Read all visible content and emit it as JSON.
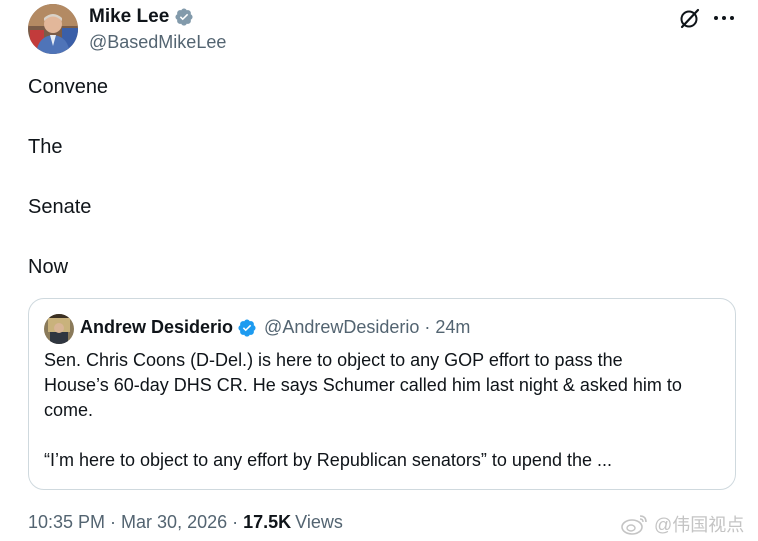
{
  "author": {
    "name": "Mike Lee",
    "handle": "@BasedMikeLee"
  },
  "tweet_lines": [
    "Convene",
    "The",
    "Senate",
    "Now"
  ],
  "quote": {
    "name": "Andrew Desiderio",
    "handle": "@AndrewDesiderio",
    "dot": "·",
    "time": "24m",
    "text_lines": [
      "Sen. Chris Coons (D-Del.) is here to object to any GOP effort to pass the",
      "House’s 60-day DHS CR. He says Schumer called him last night & asked him to",
      "come.",
      "“I’m here to object to any effort by Republican senators” to upend the ..."
    ]
  },
  "meta": {
    "time": "10:35 PM",
    "sep": "·",
    "date": "Mar 30, 2026",
    "views_count": "17.5K",
    "views_label": "Views"
  },
  "watermark": {
    "text": "@伟国视点"
  },
  "icons": {
    "verified": "verified-badge-icon",
    "grok": "grok-icon",
    "more": "more-icon",
    "weibo": "weibo-icon"
  },
  "colors": {
    "text": "#0f1419",
    "secondary": "#536471",
    "verified_blue": "#1d9bf0",
    "verified_gray": "#829aab",
    "border": "#cfd9de"
  }
}
